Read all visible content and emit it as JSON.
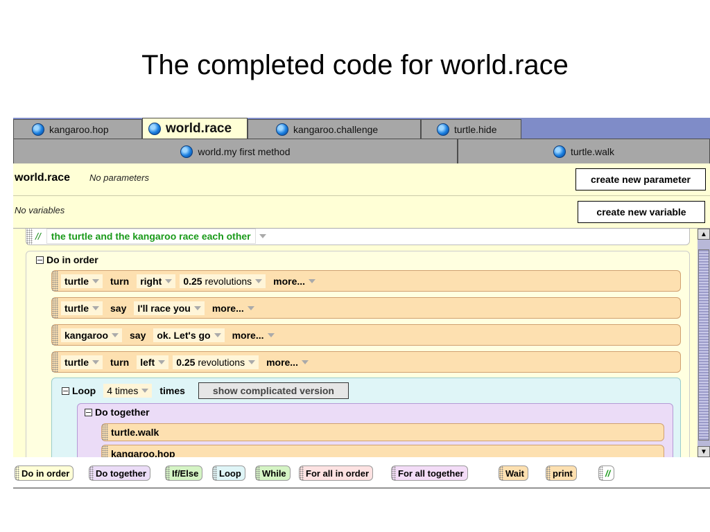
{
  "slide": {
    "title": "The completed code for world.race"
  },
  "tabs_row1": [
    {
      "label": "kangaroo.hop"
    },
    {
      "label": "world.race"
    },
    {
      "label": "kangaroo.challenge"
    },
    {
      "label": "turtle.hide"
    }
  ],
  "tabs_row2": [
    {
      "label": "world.my first method"
    },
    {
      "label": "turtle.walk"
    }
  ],
  "header": {
    "method_name": "world.race",
    "no_parameters": "No parameters",
    "no_variables": "No variables",
    "create_parameter": "create new parameter",
    "create_variable": "create new variable"
  },
  "code": {
    "comment_slashes": "//",
    "comment_text": "the turtle and the kangaroo race each other",
    "do_in_order": "Do in order",
    "statements": [
      {
        "obj": "turtle",
        "verb": "turn",
        "arg": "right",
        "amount": "0.25",
        "unit": "revolutions",
        "more": "more..."
      },
      {
        "obj": "turtle",
        "verb": "say",
        "arg": "I'll race you",
        "more": "more..."
      },
      {
        "obj": "kangaroo",
        "verb": "say",
        "arg": "ok. Let's go",
        "more": "more..."
      },
      {
        "obj": "turtle",
        "verb": "turn",
        "arg": "left",
        "amount": "0.25",
        "unit": "revolutions",
        "more": "more..."
      }
    ],
    "loop": {
      "label": "Loop",
      "count": "4 times",
      "times": "times",
      "show_button": "show complicated version",
      "do_together": "Do together",
      "calls": [
        "turtle.walk",
        "kangaroo.hop"
      ]
    }
  },
  "palette": [
    {
      "label": "Do in order",
      "color": "#ffffd6"
    },
    {
      "label": "Do together",
      "color": "#ebdcf7"
    },
    {
      "label": "If/Else",
      "color": "#d4f4c4"
    },
    {
      "label": "Loop",
      "color": "#dff5f7"
    },
    {
      "label": "While",
      "color": "#d4f4c4"
    },
    {
      "label": "For all in order",
      "color": "#fde2e2"
    },
    {
      "label": "For all together",
      "color": "#f3dcf7"
    },
    {
      "label": "Wait",
      "color": "#fde0b0"
    },
    {
      "label": "print",
      "color": "#fde0b0"
    },
    {
      "label": "//",
      "color": "#ffffff"
    }
  ],
  "colors": {
    "tab_bar": "#7f8cc8",
    "method_bg": "#ffffd6",
    "statement": "#fde0b0",
    "loop": "#dff5f7",
    "together": "#ebdcf7",
    "comment_text": "#1a9a1a"
  }
}
